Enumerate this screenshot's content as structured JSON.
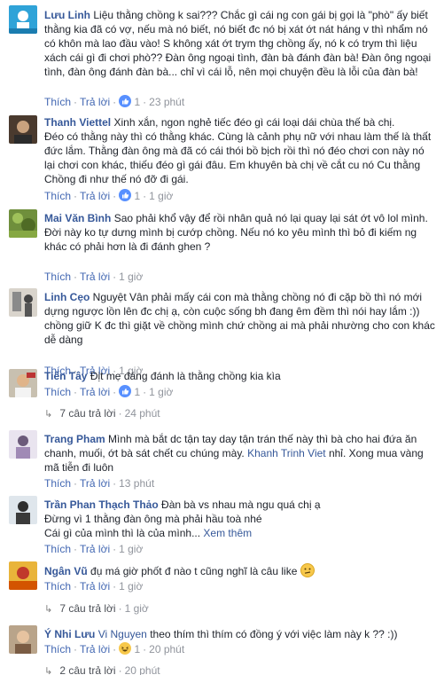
{
  "actions": {
    "like": "Thích",
    "reply": "Trả lời",
    "dot": "·"
  },
  "comments": [
    {
      "name": "Lưu Linh",
      "text": "Liệu thằng chồng k sai??? Chắc gì cái ng con gái bị gọi là \"phò\" ấy biết thằng kia đã có vợ, nếu mà nó biết, nó biết đc nó bị xát ớt nát háng v thì nhẩm nó có khôn mà lao đầu vào! S không xát ớt trym thg chồng ấy, nó k có trym thì liệu xách cái gì đi chơi phò?? Đàn ông ngoại tình, đàn bà đánh đàn bà! Đàn ông ngoại tình, đàn ông đánh đàn bà... chỉ vì cái lỗ, nên mọi chuyện đều là lỗi của đàn bà!",
      "likes": "1",
      "time": "23 phút"
    },
    {
      "name": "Thanh Viettel",
      "text": "Xinh xắn, ngon nghẻ tiếc đéo gì cái loại dái chùa thế bà chị.\nĐéo có thằng này thì có thằng khác. Cùng là cảnh phụ nữ với nhau làm thế là thất đức lắm. Thằng đàn ông mà đã có cái thói bồ bịch rồi thì nó đéo chơi con này nó lại chơi con khác, thiếu đéo gì gái đâu. Em khuyên bà chị về cắt cu nó Cu thằng Chồng đi như thế nó đỡ đi gái.",
      "likes": "1",
      "time": "1 giờ"
    },
    {
      "name": "Mai Văn Bình",
      "text": "Sao phải khổ vậy để rồi nhân quả nó lại quay lại sát ớt vô lol mình.\nĐời này ko tự dưng mình bị cướp chồng. Nếu nó ko yêu mình thì bỏ đi kiếm ng khác có phải hơn là đi đánh ghen ?",
      "time": "1 giờ"
    },
    {
      "name": "Linh Cẹo",
      "text": "Nguyệt Vân phải mấy cái con mà thằng chồng nó đi cặp bồ thì nó mới dựng ngược lồn lên đc chị ạ, còn cuộc sống bh đang êm đềm thì nói hay lắm :)) chồng giữ K đc thì giặt về chồng mình chứ chồng ai mà phải nhường cho con khác dễ dàng",
      "time": "1 giờ"
    },
    {
      "name": "Tiến Tây",
      "text": "Địt mẹ đáng đánh là thằng chồng kia kìa",
      "likes": "1",
      "time": "1 giờ",
      "replies": "7 câu trả lời",
      "replies_time": "24 phút"
    },
    {
      "name": "Trang Pham",
      "text_before": "Mình mà bắt dc tận tay day tận trán thế này thì bà cho hai đứa ăn chanh, muối, ớt bà sát chết cu chúng mày. ",
      "tag": "Khanh Trinh Viet",
      "text_after": " nhỉ. Xong mua vàng mã tiễn đi luôn",
      "time": "13 phút"
    },
    {
      "name": "Trần Phan Thạch Thảo",
      "text": "Đàn bà vs nhau mà ngu quá chị ạ\nĐừng vì 1 thằng đàn ông mà phải hầu toà nhé\nCái gì của mình thì là của mình... ",
      "more": "Xem thêm",
      "time": "1 giờ"
    },
    {
      "name": "Ngân Vũ",
      "text": "đụ má giờ phốt đ nào t cũng nghĩ là câu like ",
      "time": "1 giờ",
      "replies": "7 câu trả lời",
      "replies_time": "1 giờ"
    },
    {
      "name": "Ý Nhi Lưu",
      "tag": "Vi Nguyen",
      "text": " theo thím thì thím có đồng ý với việc làm này k ?? :))",
      "likes": "1",
      "time": "20 phút",
      "replies": "2 câu trả lời",
      "replies_time": "20 phút"
    }
  ],
  "colors": {
    "link": "#365899",
    "action": "#4267b2",
    "meta": "#90949c",
    "like_blue": "#5890ff",
    "haha_yellow": "#f7c84b"
  },
  "icons": [
    "like-reaction-icon",
    "haha-reaction-icon",
    "confused-emoji-icon",
    "reply-arrow-icon"
  ]
}
